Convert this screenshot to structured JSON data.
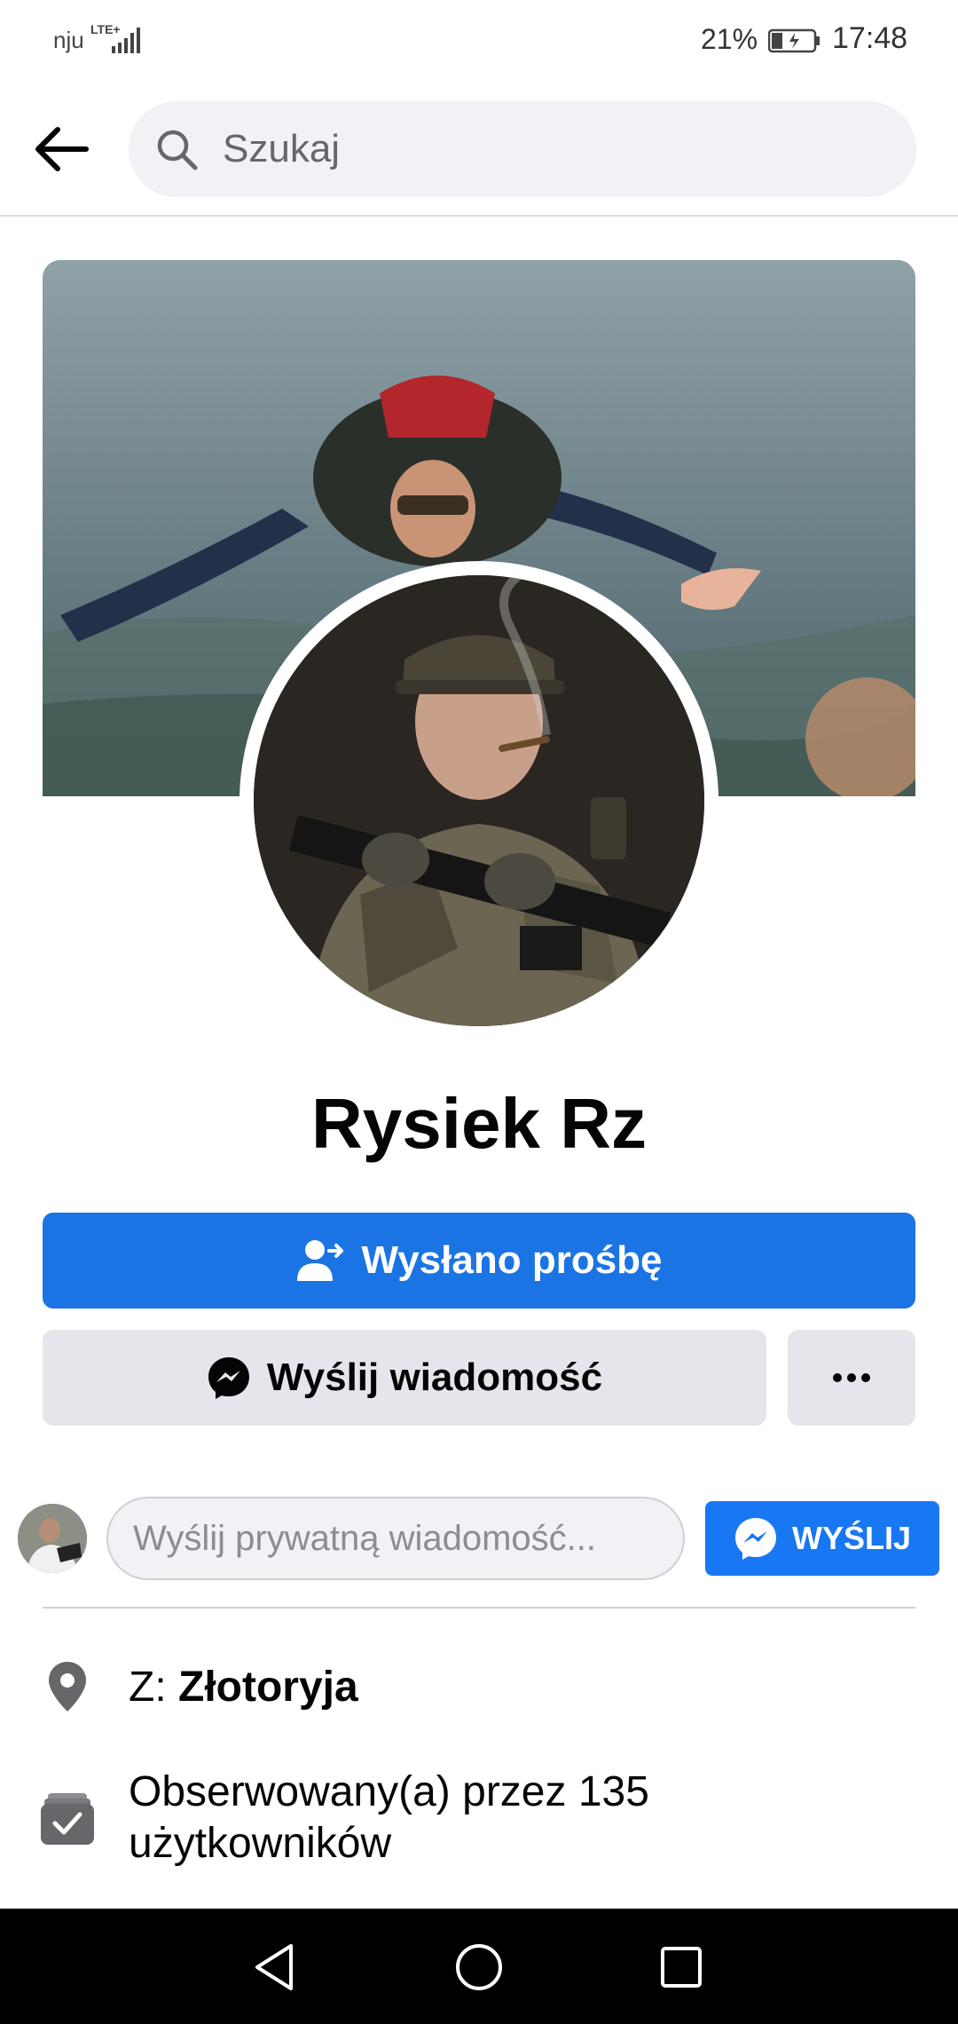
{
  "status_bar": {
    "carrier": "nju",
    "network": "LTE+",
    "battery_percent": "21%",
    "time": "17:48"
  },
  "search": {
    "placeholder": "Szukaj"
  },
  "profile": {
    "name": "Rysiek Rz"
  },
  "actions": {
    "friend_request_label": "Wysłano prośbę",
    "message_label": "Wyślij wiadomość",
    "more_label": "•••"
  },
  "quick_message": {
    "placeholder": "Wyślij prywatną wiadomość...",
    "send_label": "WYŚLIJ"
  },
  "info": {
    "location_prefix": "Z:",
    "location_value": "Złotoryja",
    "followers_line1": "Obserwowany(a) przez 135",
    "followers_line2": "użytkowników"
  },
  "colors": {
    "primary": "#1b74e4",
    "secondary_button": "#e4e6eb",
    "search_bg": "#f0f2f5"
  },
  "icons": {
    "back": "arrow-left-icon",
    "search": "search-icon",
    "friend_request": "person-arrow-icon",
    "messenger": "messenger-icon",
    "more": "more-dots-icon",
    "location": "map-pin-icon",
    "followers": "followers-check-icon"
  }
}
